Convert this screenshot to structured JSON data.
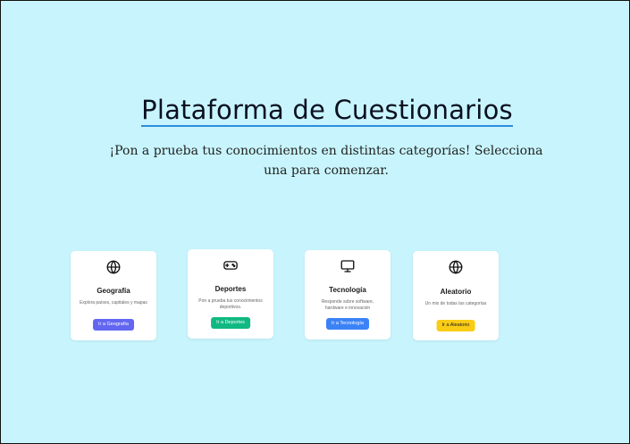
{
  "header": {
    "title": "Plataforma de Cuestionarios",
    "subtitle": "¡Pon a prueba tus conocimientos en distintas categorías! Selecciona una para comenzar."
  },
  "categories": [
    {
      "name": "Geografía",
      "icon": "globe-icon",
      "description": "Explora países, capitales y mapas",
      "button_label": "Ir a Geografía",
      "button_color": "#6366f1"
    },
    {
      "name": "Deportes",
      "icon": "gamepad-icon",
      "description": "Pon a prueba tus conocimientos deportivos.",
      "button_label": "Ir a Deportes",
      "button_color": "#10b981"
    },
    {
      "name": "Tecnología",
      "icon": "monitor-icon",
      "description": "Responde sobre software, hardware e innovación",
      "button_label": "Ir a Tecnología",
      "button_color": "#3b82f6"
    },
    {
      "name": "Aleatorio",
      "icon": "globe-icon",
      "description": "Un mix de todas las categorías",
      "button_label": "Ir a Aleatorio",
      "button_color": "#facc15"
    }
  ],
  "colors": {
    "background": "#c8f5fd",
    "title_underline": "#2f8be0"
  }
}
